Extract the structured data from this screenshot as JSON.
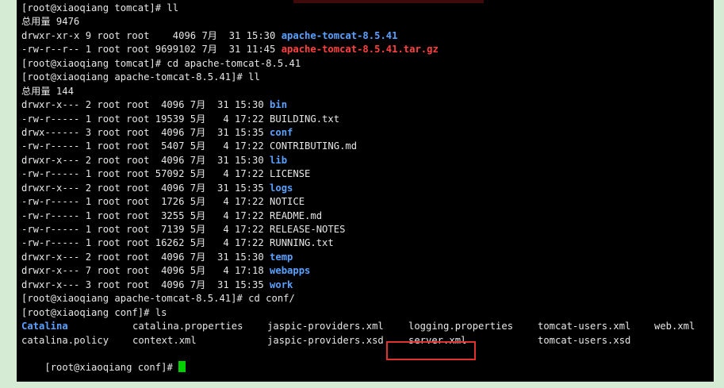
{
  "lines": [
    {
      "plain": "[root@xiaoqiang tomcat]# ll"
    },
    {
      "plain": "总用量 9476"
    },
    {
      "plain": "drwxr-xr-x 9 root root    4096 7月  31 15:30 ",
      "dir": "apache-tomcat-8.5.41"
    },
    {
      "plain": "-rw-r--r-- 1 root root 9699102 7月  31 11:45 ",
      "arch": "apache-tomcat-8.5.41.tar.gz"
    },
    {
      "plain": "[root@xiaoqiang tomcat]# cd apache-tomcat-8.5.41"
    },
    {
      "plain": "[root@xiaoqiang apache-tomcat-8.5.41]# ll"
    },
    {
      "plain": "总用量 144"
    },
    {
      "plain": "drwxr-x--- 2 root root  4096 7月  31 15:30 ",
      "dir": "bin"
    },
    {
      "plain": "-rw-r----- 1 root root 19539 5月   4 17:22 BUILDING.txt"
    },
    {
      "plain": "drwx------ 3 root root  4096 7月  31 15:35 ",
      "dir": "conf"
    },
    {
      "plain": "-rw-r----- 1 root root  5407 5月   4 17:22 CONTRIBUTING.md"
    },
    {
      "plain": "drwxr-x--- 2 root root  4096 7月  31 15:30 ",
      "dir": "lib"
    },
    {
      "plain": "-rw-r----- 1 root root 57092 5月   4 17:22 LICENSE"
    },
    {
      "plain": "drwxr-x--- 2 root root  4096 7月  31 15:35 ",
      "dir": "logs"
    },
    {
      "plain": "-rw-r----- 1 root root  1726 5月   4 17:22 NOTICE"
    },
    {
      "plain": "-rw-r----- 1 root root  3255 5月   4 17:22 README.md"
    },
    {
      "plain": "-rw-r----- 1 root root  7139 5月   4 17:22 RELEASE-NOTES"
    },
    {
      "plain": "-rw-r----- 1 root root 16262 5月   4 17:22 RUNNING.txt"
    },
    {
      "plain": "drwxr-x--- 2 root root  4096 7月  31 15:30 ",
      "dir": "temp"
    },
    {
      "plain": "drwxr-x--- 7 root root  4096 5月   4 17:18 ",
      "dir": "webapps"
    },
    {
      "plain": "drwxr-x--- 3 root root  4096 7月  31 15:35 ",
      "dir": "work"
    },
    {
      "plain": "[root@xiaoqiang apache-tomcat-8.5.41]# cd conf/"
    },
    {
      "plain": "[root@xiaoqiang conf]# ls"
    }
  ],
  "ls_rows": [
    [
      {
        "text": "Catalina",
        "type": "dir"
      },
      {
        "text": "catalina.properties",
        "type": "plain"
      },
      {
        "text": "jaspic-providers.xml",
        "type": "plain"
      },
      {
        "text": "logging.properties",
        "type": "plain"
      },
      {
        "text": "tomcat-users.xml",
        "type": "plain"
      },
      {
        "text": "web.xml",
        "type": "plain"
      }
    ],
    [
      {
        "text": "catalina.policy",
        "type": "plain"
      },
      {
        "text": "context.xml",
        "type": "plain"
      },
      {
        "text": "jaspic-providers.xsd",
        "type": "plain"
      },
      {
        "text": "server.xml",
        "type": "plain"
      },
      {
        "text": "tomcat-users.xsd",
        "type": "plain"
      },
      {
        "text": "",
        "type": "plain"
      }
    ]
  ],
  "prompt": "[root@xiaoqiang conf]# ",
  "colors": {
    "dir": "#5aa0ff",
    "archive": "#ff4040",
    "cursor": "#00d000",
    "highlight": "#e03030"
  },
  "cursor_icon": "block-cursor-icon"
}
